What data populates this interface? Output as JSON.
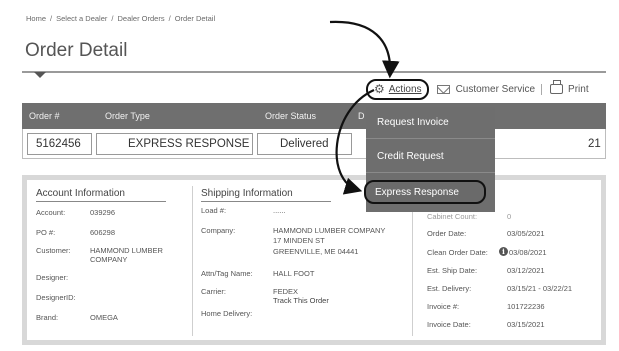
{
  "breadcrumb": {
    "items": [
      "Home",
      "Select a Dealer",
      "Dealer Orders",
      "Order Detail"
    ]
  },
  "page": {
    "title": "Order Detail"
  },
  "actions": {
    "actions_label": "Actions",
    "customer_service_label": "Customer Service",
    "print_label": "Print"
  },
  "order_table": {
    "headers": [
      "Order #",
      "Order Type",
      "Order Status",
      "D"
    ],
    "row": {
      "order_number": "5162456",
      "order_type": "EXPRESS RESPONSE",
      "order_status": "Delivered",
      "partial_date": "21"
    }
  },
  "dropdown": {
    "items": [
      "Request Invoice",
      "Credit Request",
      "Express Response"
    ]
  },
  "account": {
    "heading": "Account Information",
    "fields": [
      {
        "label": "Account:",
        "value": "039296"
      },
      {
        "label": "PO #:",
        "value": "606298"
      },
      {
        "label": "Customer:",
        "value": "HAMMOND LUMBER COMPANY"
      },
      {
        "label": "Designer:",
        "value": ""
      },
      {
        "label": "DesignerID:",
        "value": ""
      },
      {
        "label": "Brand:",
        "value": "OMEGA"
      }
    ]
  },
  "shipping": {
    "heading": "Shipping Information",
    "load_label": "Load #:",
    "load_value": "......",
    "company_label": "Company:",
    "company_line1": "HAMMOND LUMBER COMPANY",
    "company_line2": "17 MINDEN ST",
    "company_line3": "GREENVILLE, ME 04441",
    "attn_label": "Attn/Tag Name:",
    "attn_value": "HALL FOOT",
    "carrier_label": "Carrier:",
    "carrier_value": "FEDEX",
    "track_label": "Track This Order",
    "home_delivery_label": "Home Delivery:"
  },
  "details": {
    "cabinet_label": "Cabinet Count:",
    "cabinet_value": "0",
    "order_date_label": "Order Date:",
    "order_date_value": "03/05/2021",
    "clean_label": "Clean Order Date:",
    "clean_value": "03/08/2021",
    "ship_label": "Est. Ship Date:",
    "ship_value": "03/12/2021",
    "delivery_label": "Est. Delivery:",
    "delivery_value": "03/15/21 - 03/22/21",
    "invoice_label": "Invoice #:",
    "invoice_value": "101722236",
    "invoice_date_label": "Invoice Date:",
    "invoice_date_value": "03/15/2021"
  },
  "colors": {
    "header_bg": "#6f6f6f",
    "dropdown_bg": "#6e6e6e",
    "highlight_border": "#111111"
  }
}
